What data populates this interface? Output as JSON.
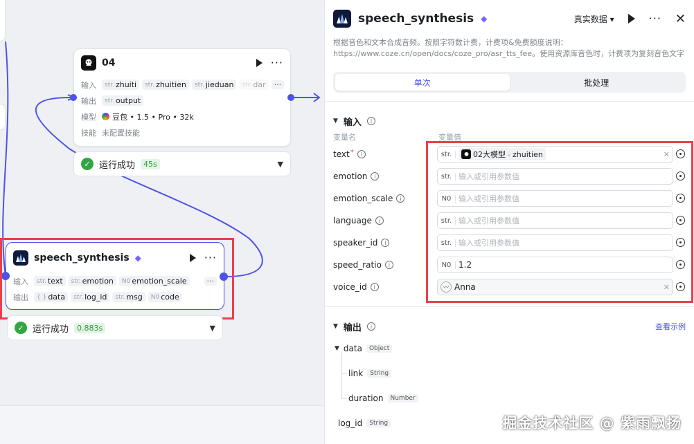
{
  "canvas": {
    "node04": {
      "title": "04",
      "input_label": "输入",
      "inputs": [
        {
          "type": "str.",
          "name": "zhuiti"
        },
        {
          "type": "str.",
          "name": "zhuitien"
        },
        {
          "type": "str.",
          "name": "jieduan"
        },
        {
          "type": "str.",
          "name": "dar"
        }
      ],
      "more": "···",
      "output_label": "输出",
      "outputs": [
        {
          "type": "str.",
          "name": "output"
        }
      ],
      "model_label": "模型",
      "model_value": "豆包 • 1.5 • Pro • 32k",
      "skill_label": "技能",
      "skill_value": "未配置技能"
    },
    "node04_status": {
      "text": "运行成功",
      "time": "45s"
    },
    "speech_node": {
      "title": "speech_synthesis",
      "input_label": "输入",
      "inputs": [
        {
          "type": "str.",
          "name": "text"
        },
        {
          "type": "str.",
          "name": "emotion"
        },
        {
          "type": "N0",
          "name": "emotion_scale"
        }
      ],
      "more": "···",
      "output_label": "输出",
      "outputs": [
        {
          "type": "{ }",
          "name": "data"
        },
        {
          "type": "str.",
          "name": "log_id"
        },
        {
          "type": "str.",
          "name": "msg"
        },
        {
          "type": "N0",
          "name": "code"
        }
      ]
    },
    "speech_status": {
      "text": "运行成功",
      "time": "0.883s"
    }
  },
  "panel": {
    "title": "speech_synthesis",
    "mode": "真实数据",
    "description": "根据音色和文本合成音频。按照字符数计费，计费项&免费额度说明：https://www.coze.cn/open/docs/coze_pro/asr_tts_fee。使用资源库音色时，计费项为复刻音色文字转语音字数；使用预设...",
    "tabs": [
      "单次",
      "批处理"
    ],
    "input_section": "输入",
    "col_name": "变量名",
    "col_value": "变量值",
    "params": [
      {
        "name": "text",
        "required": "*",
        "type": "str.",
        "ref_node": "02大模型",
        "ref_var": "zhuitien",
        "value": "",
        "placeholder": ""
      },
      {
        "name": "emotion",
        "required": "",
        "type": "str.",
        "value": "",
        "placeholder": "输入或引用参数值"
      },
      {
        "name": "emotion_scale",
        "required": "",
        "type": "N0",
        "value": "",
        "placeholder": "输入或引用参数值"
      },
      {
        "name": "language",
        "required": "",
        "type": "str.",
        "value": "",
        "placeholder": "输入或引用参数值"
      },
      {
        "name": "speaker_id",
        "required": "",
        "type": "str.",
        "value": "",
        "placeholder": "输入或引用参数值"
      },
      {
        "name": "speed_ratio",
        "required": "",
        "type": "N0",
        "value": "1.2",
        "placeholder": ""
      },
      {
        "name": "voice_id",
        "required": "",
        "type": "",
        "value": "Anna",
        "placeholder": ""
      }
    ],
    "output_section": "输出",
    "view_example": "查看示例",
    "outputs": [
      {
        "name": "data",
        "type": "Object"
      },
      {
        "name": "link",
        "type": "String"
      },
      {
        "name": "duration",
        "type": "Number"
      },
      {
        "name": "log_id",
        "type": "String"
      }
    ]
  },
  "watermark": "掘金技术社区 @ 紫雨飘扬",
  "colors": {
    "accent": "#4d53e8",
    "highlight": "#e8414b",
    "success": "#32a645"
  }
}
